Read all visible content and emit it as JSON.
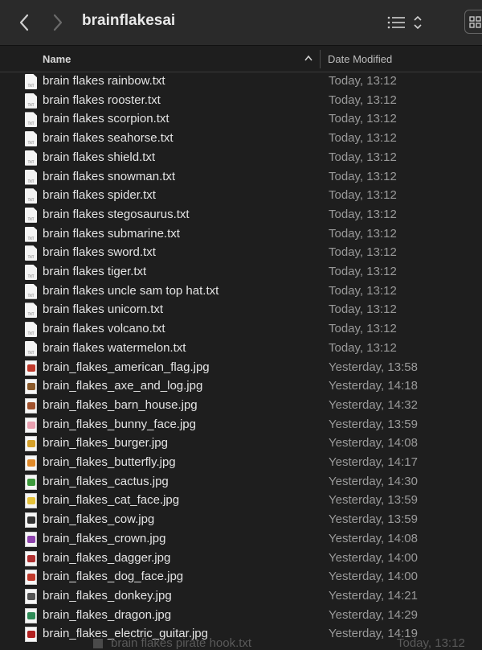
{
  "window": {
    "title": "brainflakesai"
  },
  "toolbar": {
    "back_icon": "chevron-left-icon",
    "forward_icon": "chevron-right-icon",
    "view_icon": "list-view-icon",
    "grid_icon": "grid-icon"
  },
  "columns": {
    "name": "Name",
    "date_modified": "Date Modified"
  },
  "files": [
    {
      "name": "brain flakes rainbow.txt",
      "date": "Today, 13:12",
      "kind": "txt"
    },
    {
      "name": "brain flakes rooster.txt",
      "date": "Today, 13:12",
      "kind": "txt"
    },
    {
      "name": "brain flakes scorpion.txt",
      "date": "Today, 13:12",
      "kind": "txt"
    },
    {
      "name": "brain flakes seahorse.txt",
      "date": "Today, 13:12",
      "kind": "txt"
    },
    {
      "name": "brain flakes shield.txt",
      "date": "Today, 13:12",
      "kind": "txt"
    },
    {
      "name": "brain flakes snowman.txt",
      "date": "Today, 13:12",
      "kind": "txt"
    },
    {
      "name": "brain flakes spider.txt",
      "date": "Today, 13:12",
      "kind": "txt"
    },
    {
      "name": "brain flakes stegosaurus.txt",
      "date": "Today, 13:12",
      "kind": "txt"
    },
    {
      "name": "brain flakes submarine.txt",
      "date": "Today, 13:12",
      "kind": "txt"
    },
    {
      "name": "brain flakes sword.txt",
      "date": "Today, 13:12",
      "kind": "txt"
    },
    {
      "name": "brain flakes tiger.txt",
      "date": "Today, 13:12",
      "kind": "txt"
    },
    {
      "name": "brain flakes uncle sam top hat.txt",
      "date": "Today, 13:12",
      "kind": "txt"
    },
    {
      "name": "brain flakes unicorn.txt",
      "date": "Today, 13:12",
      "kind": "txt"
    },
    {
      "name": "brain flakes volcano.txt",
      "date": "Today, 13:12",
      "kind": "txt"
    },
    {
      "name": "brain flakes watermelon.txt",
      "date": "Today, 13:12",
      "kind": "txt"
    },
    {
      "name": "brain_flakes_american_flag.jpg",
      "date": "Yesterday, 13:58",
      "kind": "jpg",
      "color": "#c0392b"
    },
    {
      "name": "brain_flakes_axe_and_log.jpg",
      "date": "Yesterday, 14:18",
      "kind": "jpg",
      "color": "#8b5a2b"
    },
    {
      "name": "brain_flakes_barn_house.jpg",
      "date": "Yesterday, 14:32",
      "kind": "jpg",
      "color": "#a0522d"
    },
    {
      "name": "brain_flakes_bunny_face.jpg",
      "date": "Yesterday, 13:59",
      "kind": "jpg",
      "color": "#e8a0b0"
    },
    {
      "name": "brain_flakes_burger.jpg",
      "date": "Yesterday, 14:08",
      "kind": "jpg",
      "color": "#d4a02a"
    },
    {
      "name": "brain_flakes_butterfly.jpg",
      "date": "Yesterday, 14:17",
      "kind": "jpg",
      "color": "#e08a2a"
    },
    {
      "name": "brain_flakes_cactus.jpg",
      "date": "Yesterday, 14:30",
      "kind": "jpg",
      "color": "#3c9a3c"
    },
    {
      "name": "brain_flakes_cat_face.jpg",
      "date": "Yesterday, 13:59",
      "kind": "jpg",
      "color": "#e6c23a"
    },
    {
      "name": "brain_flakes_cow.jpg",
      "date": "Yesterday, 13:59",
      "kind": "jpg",
      "color": "#333333"
    },
    {
      "name": "brain_flakes_crown.jpg",
      "date": "Yesterday, 14:08",
      "kind": "jpg",
      "color": "#8e44ad"
    },
    {
      "name": "brain_flakes_dagger.jpg",
      "date": "Yesterday, 14:00",
      "kind": "jpg",
      "color": "#b03030"
    },
    {
      "name": "brain_flakes_dog_face.jpg",
      "date": "Yesterday, 14:00",
      "kind": "jpg",
      "color": "#c0392b"
    },
    {
      "name": "brain_flakes_donkey.jpg",
      "date": "Yesterday, 14:21",
      "kind": "jpg",
      "color": "#555555"
    },
    {
      "name": "brain_flakes_dragon.jpg",
      "date": "Yesterday, 14:29",
      "kind": "jpg",
      "color": "#2e8b57"
    },
    {
      "name": "brain_flakes_electric_guitar.jpg",
      "date": "Yesterday, 14:19",
      "kind": "jpg",
      "color": "#b22222"
    }
  ],
  "drag_ghost": {
    "name": "brain flakes pirate hook.txt",
    "date": "Today, 13:12"
  }
}
